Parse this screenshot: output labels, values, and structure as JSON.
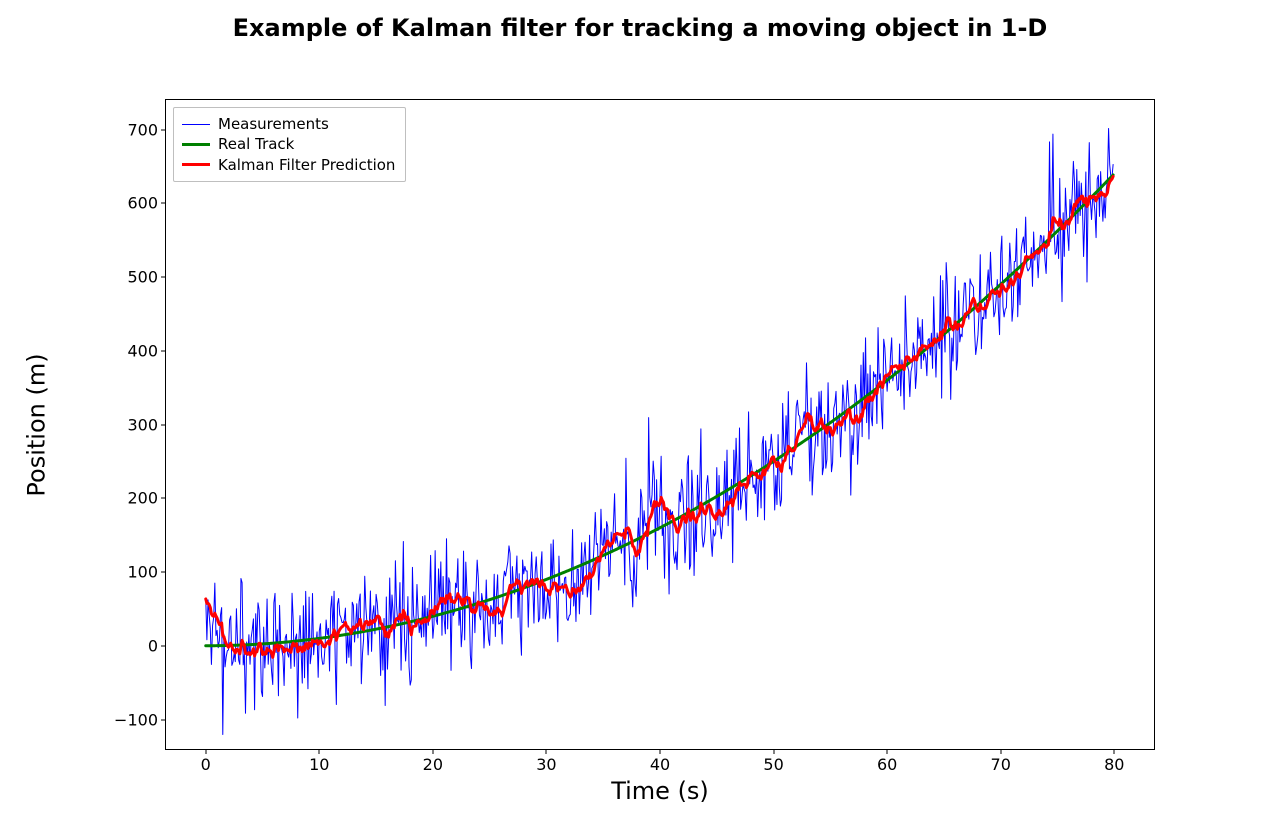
{
  "chart_data": {
    "type": "line",
    "title": "Example of Kalman filter for tracking a moving object in 1-D",
    "xlabel": "Time (s)",
    "ylabel": "Position (m)",
    "xlim": [
      -3.5,
      83.5
    ],
    "ylim": [
      -140,
      740
    ],
    "xticks": [
      0,
      10,
      20,
      30,
      40,
      50,
      60,
      70,
      80
    ],
    "yticks": [
      -100,
      0,
      100,
      200,
      300,
      400,
      500,
      600,
      700
    ],
    "legend": [
      "Measurements",
      "Real Track",
      "Kalman Filter Prediction"
    ],
    "legend_loc": "upper left",
    "x_description": "800 uniformly spaced samples over t ∈ [0, 80] s, step 0.1 s",
    "x_range": [
      0,
      80
    ],
    "x_step": 0.1,
    "x_count": 800,
    "noise_sigma_measurement": 45,
    "series": [
      {
        "name": "Measurements",
        "color": "#0000ff",
        "linewidth": 1,
        "model": "Real Track + Gaussian noise (σ ≈ 45 m)",
        "values_at_x_ticks": [
          0,
          10,
          30,
          60,
          90,
          200,
          290,
          450,
          640
        ],
        "values_min_max_approx": [
          -100,
          700
        ]
      },
      {
        "name": "Real Track",
        "color": "#008000",
        "linewidth": 3,
        "model": "y = 0.1 * t^2  (position under constant acceleration a = 0.2 m/s²)",
        "values_at_x_ticks": [
          0,
          10,
          40,
          90,
          160,
          250,
          360,
          490,
          640
        ]
      },
      {
        "name": "Kalman Filter Prediction",
        "color": "#ff0000",
        "linewidth": 3,
        "model": "Kalman-filtered estimate of Measurements; approximately follows Real Track with small lag/ripple",
        "values_at_x_ticks": [
          0,
          8,
          35,
          85,
          155,
          250,
          360,
          490,
          635
        ]
      }
    ],
    "colors": {
      "measurements": "#0000ff",
      "real_track": "#008000",
      "kalman": "#ff0000"
    }
  }
}
